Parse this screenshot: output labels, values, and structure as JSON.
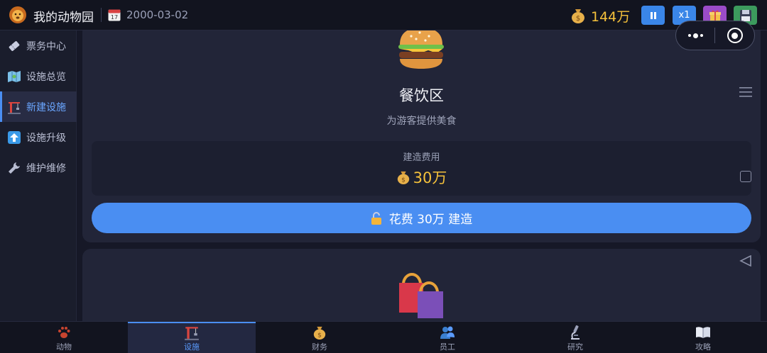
{
  "topbar": {
    "title": "我的动物园",
    "date": "2000-03-02",
    "calendar_day": "17",
    "money": "144万",
    "speed_label": "x1"
  },
  "sidebar": {
    "items": [
      {
        "label": "票务中心",
        "icon": "ticket-icon",
        "active": false
      },
      {
        "label": "设施总览",
        "icon": "map-icon",
        "active": false
      },
      {
        "label": "新建设施",
        "icon": "construction-crane-icon",
        "active": true
      },
      {
        "label": "设施升级",
        "icon": "up-arrow-icon",
        "active": false
      },
      {
        "label": "维护维修",
        "icon": "wrench-icon",
        "active": false
      }
    ]
  },
  "facility": {
    "name": "餐饮区",
    "description": "为游客提供美食",
    "cost_label": "建造费用",
    "cost_value": "30万",
    "build_button": "花费 30万 建造"
  },
  "bottom_nav": {
    "items": [
      {
        "label": "动物",
        "icon": "paw-icon"
      },
      {
        "label": "设施",
        "icon": "construction-crane-icon",
        "active": true
      },
      {
        "label": "财务",
        "icon": "money-bag-icon"
      },
      {
        "label": "员工",
        "icon": "staff-icon"
      },
      {
        "label": "研究",
        "icon": "microscope-icon"
      },
      {
        "label": "攻略",
        "icon": "book-icon"
      }
    ]
  },
  "colors": {
    "accent": "#4a8ef2",
    "money": "#f5c13b",
    "background": "#161827",
    "card": "#222538"
  }
}
